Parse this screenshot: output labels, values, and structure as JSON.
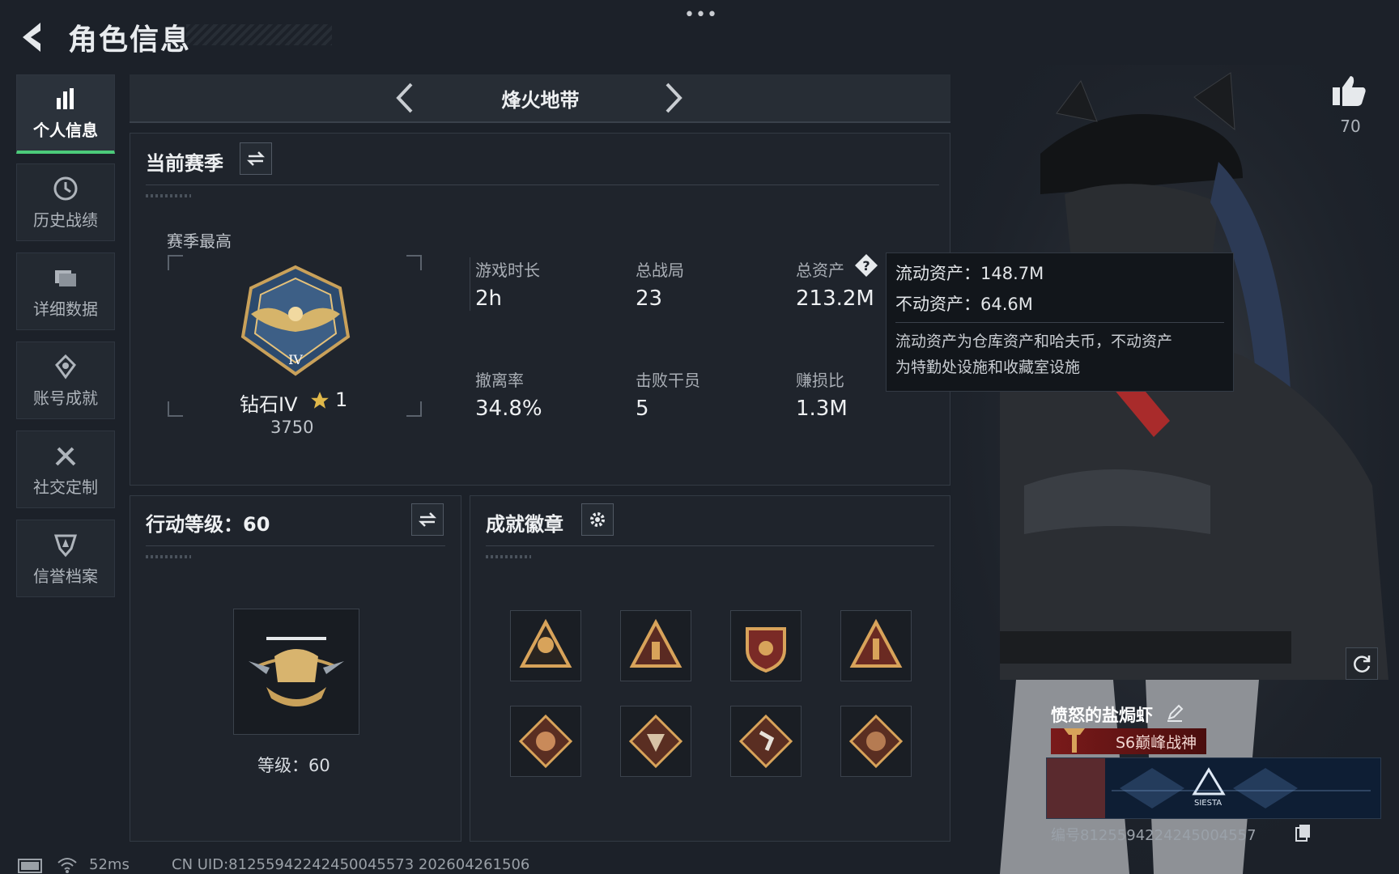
{
  "header": {
    "title": "角色信息",
    "more_label": "•••"
  },
  "sidebar": {
    "items": [
      {
        "label": "个人信息",
        "icon": "bar-chart-icon",
        "active": true
      },
      {
        "label": "历史战绩",
        "icon": "history-icon"
      },
      {
        "label": "详细数据",
        "icon": "folder-icon"
      },
      {
        "label": "账号成就",
        "icon": "achievement-icon"
      },
      {
        "label": "社交定制",
        "icon": "tools-icon"
      },
      {
        "label": "信誉档案",
        "icon": "credit-icon"
      }
    ]
  },
  "mode": {
    "title": "烽火地带"
  },
  "season": {
    "section_title": "当前赛季",
    "best_label": "赛季最高",
    "rank_name": "钻石IV",
    "rank_stars": "1",
    "rank_score": "3750",
    "stats": [
      {
        "label": "游戏时长",
        "value": "2h"
      },
      {
        "label": "总战局",
        "value": "23"
      },
      {
        "label": "总资产",
        "value": "213.2M"
      },
      {
        "label": "撤离率",
        "value": "34.8%"
      },
      {
        "label": "击败干员",
        "value": "5"
      },
      {
        "label": "赚损比",
        "value": "1.3M"
      }
    ]
  },
  "tooltip": {
    "liquid": "流动资产：148.7M",
    "fixed": "不动资产：64.6M",
    "note_line1": "流动资产为仓库资产和哈夫币，不动资产",
    "note_line2": "为特勤处设施和收藏室设施"
  },
  "action_level": {
    "section_title": "行动等级：60",
    "level_text": "等级：60"
  },
  "badges": {
    "section_title": "成就徽章",
    "items": [
      "s4-triangle-badge",
      "triangle-badge",
      "shield-stars-badge",
      "rank-one-badge",
      "dragon-badge",
      "wolf-badge",
      "runner-badge",
      "dragon-badge-2"
    ]
  },
  "profile": {
    "like_count": "70",
    "player_name": "愤怒的盐焗虾",
    "title": "S6巅峰战神",
    "banner_brand": "SIESTA",
    "uid_text": "编号8125594224245004557"
  },
  "footer": {
    "ping": "52ms",
    "uid": "CN UID:81255942242450045573 202604261506"
  },
  "colors": {
    "accent_green": "#4ccb7a",
    "title_red": "#7a1a1a",
    "bg": "#1c2129"
  }
}
